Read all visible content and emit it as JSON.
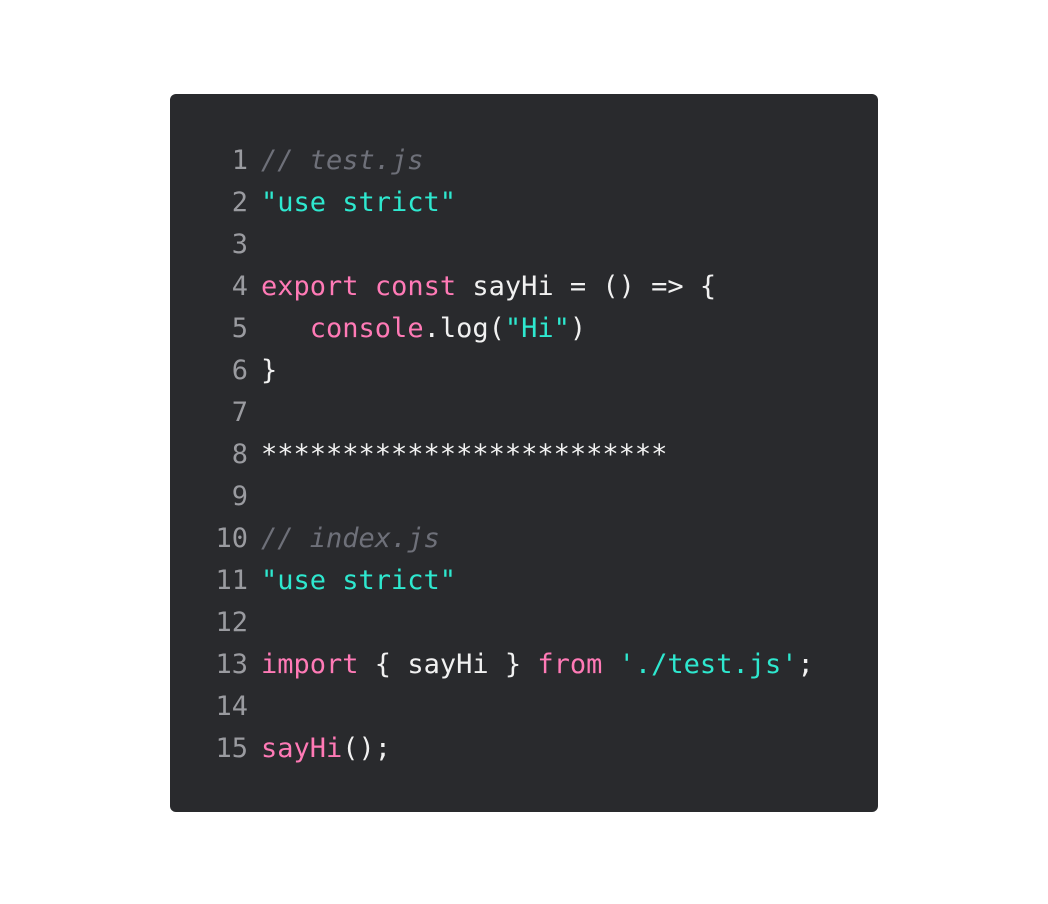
{
  "colors": {
    "background": "#ffffff",
    "editor_bg": "#292a2d",
    "line_number": "#9a9ba0",
    "comment": "#6e7079",
    "string": "#2ee8cf",
    "keyword": "#ff7ab6",
    "plain": "#f1f1f1"
  },
  "code": {
    "lines": [
      {
        "number": "1",
        "tokens": [
          {
            "type": "comment",
            "text": "// test.js"
          }
        ]
      },
      {
        "number": "2",
        "tokens": [
          {
            "type": "string",
            "text": "\"use strict\""
          }
        ]
      },
      {
        "number": "3",
        "tokens": []
      },
      {
        "number": "4",
        "tokens": [
          {
            "type": "keyword",
            "text": "export"
          },
          {
            "type": "plain",
            "text": " "
          },
          {
            "type": "keyword",
            "text": "const"
          },
          {
            "type": "plain",
            "text": " sayHi = () => {"
          }
        ]
      },
      {
        "number": "5",
        "tokens": [
          {
            "type": "plain",
            "text": "   "
          },
          {
            "type": "keyword",
            "text": "console"
          },
          {
            "type": "plain",
            "text": ".log("
          },
          {
            "type": "string",
            "text": "\"Hi\""
          },
          {
            "type": "plain",
            "text": ")"
          }
        ]
      },
      {
        "number": "6",
        "tokens": [
          {
            "type": "plain",
            "text": "}"
          }
        ]
      },
      {
        "number": "7",
        "tokens": []
      },
      {
        "number": "8",
        "tokens": [
          {
            "type": "plain",
            "text": "*************************"
          }
        ]
      },
      {
        "number": "9",
        "tokens": []
      },
      {
        "number": "10",
        "tokens": [
          {
            "type": "comment",
            "text": "// index.js"
          }
        ]
      },
      {
        "number": "11",
        "tokens": [
          {
            "type": "string",
            "text": "\"use strict\""
          }
        ]
      },
      {
        "number": "12",
        "tokens": []
      },
      {
        "number": "13",
        "tokens": [
          {
            "type": "keyword",
            "text": "import"
          },
          {
            "type": "plain",
            "text": " { sayHi } "
          },
          {
            "type": "keyword",
            "text": "from"
          },
          {
            "type": "plain",
            "text": " "
          },
          {
            "type": "string",
            "text": "'./test.js'"
          },
          {
            "type": "plain",
            "text": ";"
          }
        ]
      },
      {
        "number": "14",
        "tokens": []
      },
      {
        "number": "15",
        "tokens": [
          {
            "type": "keyword",
            "text": "sayHi"
          },
          {
            "type": "plain",
            "text": "();"
          }
        ]
      }
    ]
  }
}
